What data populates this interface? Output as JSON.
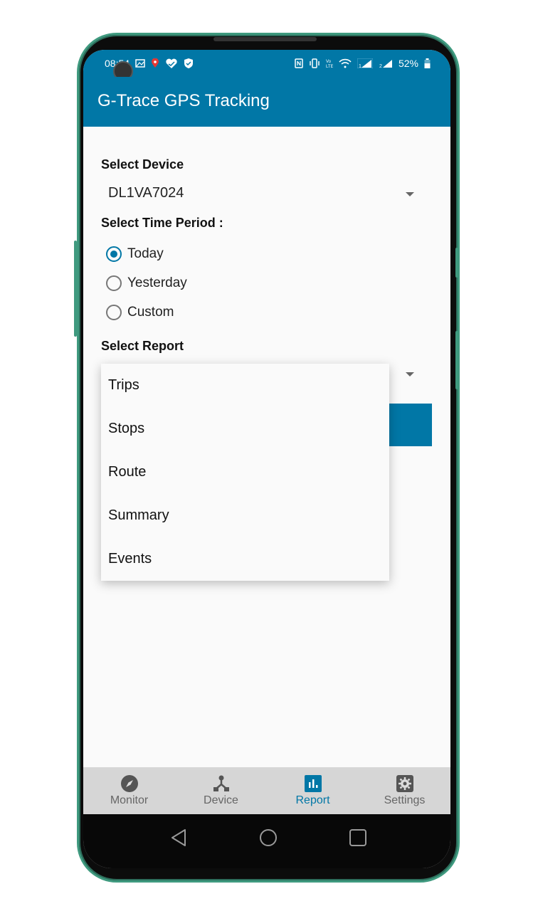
{
  "colors": {
    "accent": "#0177a6",
    "nav_bg": "#d6d6d6",
    "frame": "#3f9a7f"
  },
  "statusbar": {
    "time": "08:54",
    "left_icons": [
      "gallery-icon",
      "location-pin-icon",
      "health-icon",
      "shield-check-icon"
    ],
    "right_icons": [
      "nfc-icon",
      "vibrate-icon",
      "volte-icon",
      "wifi-icon",
      "signal-sim1-icon",
      "signal-sim2-icon"
    ],
    "battery": "52%"
  },
  "appbar": {
    "title": "G-Trace GPS Tracking"
  },
  "form": {
    "device_label": "Select Device",
    "device_value": "DL1VA7024",
    "time_label": "Select Time Period :",
    "time_options": [
      {
        "label": "Today",
        "checked": true
      },
      {
        "label": "Yesterday",
        "checked": false
      },
      {
        "label": "Custom",
        "checked": false
      }
    ],
    "report_label": "Select Report"
  },
  "report_dropdown": {
    "items": [
      "Trips",
      "Stops",
      "Route",
      "Summary",
      "Events"
    ]
  },
  "bottom_nav": {
    "items": [
      {
        "label": "Monitor",
        "icon": "compass-icon",
        "active": false
      },
      {
        "label": "Device",
        "icon": "device-tree-icon",
        "active": false
      },
      {
        "label": "Report",
        "icon": "report-chart-icon",
        "active": true
      },
      {
        "label": "Settings",
        "icon": "settings-gear-icon",
        "active": false
      }
    ]
  },
  "system_nav": {
    "buttons": [
      "back",
      "home",
      "recents"
    ]
  }
}
